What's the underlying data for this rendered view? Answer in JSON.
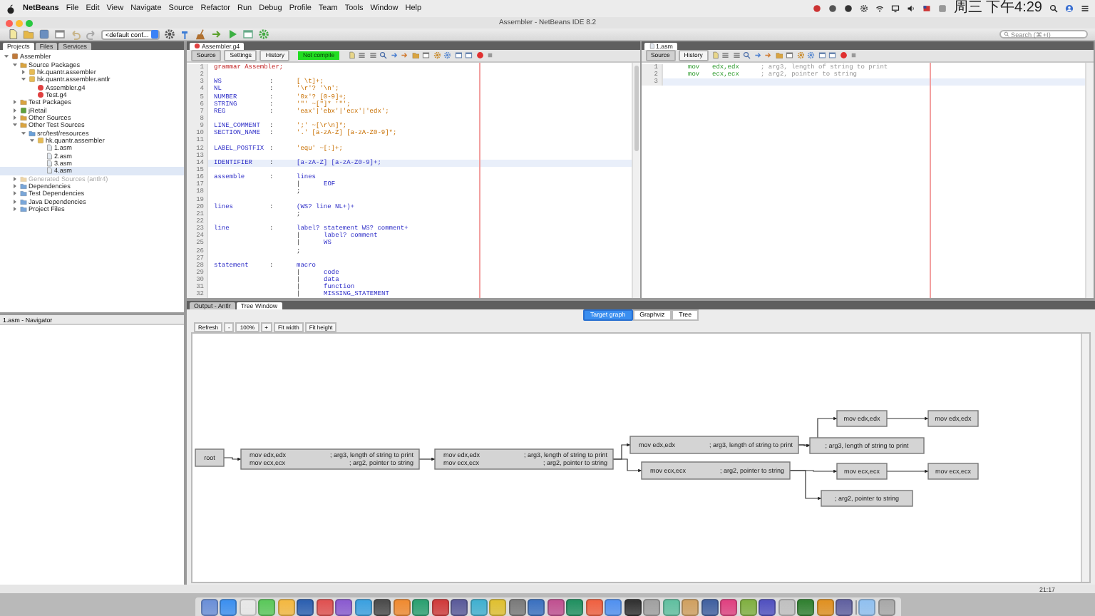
{
  "menubar": {
    "app": "NetBeans",
    "menus": [
      "File",
      "Edit",
      "View",
      "Navigate",
      "Source",
      "Refactor",
      "Run",
      "Debug",
      "Profile",
      "Team",
      "Tools",
      "Window",
      "Help"
    ],
    "clock": "周三 下午4:29"
  },
  "window": {
    "title": "Assembler - NetBeans IDE 8.2"
  },
  "toolbar": {
    "config": "<default conf...",
    "search": {
      "placeholder": "Search (⌘+I)"
    }
  },
  "left_tabs": [
    {
      "label": "Projects",
      "selected": true
    },
    {
      "label": "Files",
      "selected": false
    },
    {
      "label": "Services",
      "selected": false
    }
  ],
  "project_tree": [
    {
      "label": "Assembler",
      "kind": "project",
      "expanded": true,
      "selected": false,
      "children": [
        {
          "label": "Source Packages",
          "kind": "source-root",
          "expanded": true,
          "selected": false,
          "disabled": false,
          "children": [
            {
              "label": "hk.quantr.assembler",
              "kind": "package",
              "expanded": false,
              "selected": false
            },
            {
              "label": "hk.quantr.assembler.antlr",
              "kind": "package",
              "expanded": true,
              "selected": false,
              "children": [
                {
                  "label": "Assembler.g4",
                  "kind": "grammar",
                  "selected": false
                },
                {
                  "label": "Test.g4",
                  "kind": "grammar",
                  "selected": false
                }
              ]
            }
          ]
        },
        {
          "label": "Test Packages",
          "kind": "source-root",
          "expanded": false,
          "selected": false,
          "disabled": false
        },
        {
          "label": "jRetail",
          "kind": "library",
          "expanded": false,
          "selected": false,
          "disabled": false
        },
        {
          "label": "Other Sources",
          "kind": "source-root",
          "expanded": false,
          "selected": false,
          "disabled": false
        },
        {
          "label": "Other Test Sources",
          "kind": "source-root",
          "expanded": true,
          "selected": false,
          "disabled": false,
          "children": [
            {
              "label": "src/test/resources",
              "kind": "folder",
              "expanded": true,
              "selected": false,
              "children": [
                {
                  "label": "hk.quantr.assembler",
                  "kind": "package",
                  "expanded": true,
                  "selected": false,
                  "children": [
                    {
                      "label": "1.asm",
                      "kind": "asm",
                      "selected": false
                    },
                    {
                      "label": "2.asm",
                      "kind": "asm",
                      "selected": false
                    },
                    {
                      "label": "3.asm",
                      "kind": "asm",
                      "selected": false
                    },
                    {
                      "label": "4.asm",
                      "kind": "asm",
                      "selected": true
                    }
                  ]
                }
              ]
            }
          ]
        },
        {
          "label": "Generated Sources (antlr4)",
          "kind": "source-root",
          "expanded": false,
          "selected": false,
          "disabled": true
        },
        {
          "label": "Dependencies",
          "kind": "deps",
          "expanded": false,
          "selected": false,
          "disabled": false
        },
        {
          "label": "Test Dependencies",
          "kind": "deps",
          "expanded": false,
          "selected": false,
          "disabled": false
        },
        {
          "label": "Java Dependencies",
          "kind": "deps",
          "expanded": false,
          "selected": false,
          "disabled": false
        },
        {
          "label": "Project Files",
          "kind": "deps",
          "expanded": false,
          "selected": false,
          "disabled": false
        }
      ]
    }
  ],
  "navigator": {
    "title": "1.asm - Navigator"
  },
  "editors": [
    {
      "tab": "Assembler.g4",
      "kind": "grammar",
      "views": [
        {
          "label": "Source",
          "selected": true
        },
        {
          "label": "Settings",
          "selected": false
        },
        {
          "label": "History",
          "selected": false
        }
      ],
      "status": "Not compile",
      "lines": [
        {
          "number": "1",
          "kind": "header",
          "text": "grammar Assembler;",
          "current": false
        },
        {
          "number": "2",
          "kind": "blank",
          "current": false
        },
        {
          "number": "3",
          "kind": "lexer",
          "name": "WS",
          "sep": ":",
          "code": "[ \\t]+;",
          "current": false
        },
        {
          "number": "4",
          "kind": "lexer",
          "name": "NL",
          "sep": ":",
          "code": "'\\r'? '\\n';",
          "current": false
        },
        {
          "number": "5",
          "kind": "lexer",
          "name": "NUMBER",
          "sep": ":",
          "code": "'0x'? [0-9]+;",
          "current": false
        },
        {
          "number": "6",
          "kind": "lexer",
          "name": "STRING",
          "sep": ":",
          "code": "'\"' ~[\"]* '\"';",
          "current": false
        },
        {
          "number": "7",
          "kind": "lexer",
          "name": "REG",
          "sep": ":",
          "code": "'eax'|'ebx'|'ecx'|'edx';",
          "current": false
        },
        {
          "number": "8",
          "kind": "blank",
          "current": false
        },
        {
          "number": "9",
          "kind": "lexer",
          "name": "LINE_COMMENT",
          "sep": ":",
          "code": "';' ~[\\r\\n]*;",
          "current": false
        },
        {
          "number": "10",
          "kind": "lexer",
          "name": "SECTION_NAME",
          "sep": ":",
          "code": "'.' [a-zA-Z] [a-zA-Z0-9]*;",
          "current": false
        },
        {
          "number": "11",
          "kind": "blank",
          "current": false
        },
        {
          "number": "12",
          "kind": "lexer",
          "name": "LABEL_POSTFIX",
          "sep": ":",
          "code": "'equ' ~[:]+;",
          "current": false
        },
        {
          "number": "13",
          "kind": "blank",
          "current": false
        },
        {
          "number": "14",
          "kind": "parser",
          "name": "IDENTIFIER",
          "sep": ":",
          "code": "[a-zA-Z] [a-zA-Z0-9]+;",
          "current": true
        },
        {
          "number": "15",
          "kind": "blank",
          "current": false
        },
        {
          "number": "16",
          "kind": "parser",
          "name": "assemble",
          "sep": ":",
          "code": "lines",
          "current": false
        },
        {
          "number": "17",
          "kind": "alt",
          "sep": "|",
          "code": "EOF",
          "current": false
        },
        {
          "number": "18",
          "kind": "end",
          "code": ";",
          "current": false
        },
        {
          "number": "19",
          "kind": "blank",
          "current": false
        },
        {
          "number": "20",
          "kind": "parser",
          "name": "lines",
          "sep": ":",
          "code": "(WS? line NL+)+",
          "current": false
        },
        {
          "number": "21",
          "kind": "end",
          "code": ";",
          "current": false
        },
        {
          "number": "22",
          "kind": "blank",
          "current": false
        },
        {
          "number": "23",
          "kind": "parser",
          "name": "line",
          "sep": ":",
          "code": "label? statement WS? comment+",
          "current": false
        },
        {
          "number": "24",
          "kind": "alt",
          "sep": "|",
          "code": "label? comment",
          "current": false
        },
        {
          "number": "25",
          "kind": "alt",
          "sep": "|",
          "code": "WS",
          "current": false
        },
        {
          "number": "26",
          "kind": "end",
          "code": ";",
          "current": false
        },
        {
          "number": "27",
          "kind": "blank",
          "current": false
        },
        {
          "number": "28",
          "kind": "parser",
          "name": "statement",
          "sep": ":",
          "code": "macro",
          "current": false
        },
        {
          "number": "29",
          "kind": "alt",
          "sep": "|",
          "code": "code",
          "current": false
        },
        {
          "number": "30",
          "kind": "alt",
          "sep": "|",
          "code": "data",
          "current": false
        },
        {
          "number": "31",
          "kind": "alt",
          "sep": "|",
          "code": "function",
          "current": false
        },
        {
          "number": "32",
          "kind": "alt",
          "sep": "|",
          "code": "MISSING_STATEMENT",
          "current": false
        }
      ]
    },
    {
      "tab": "1.asm",
      "kind": "asm",
      "views": [
        {
          "label": "Source",
          "selected": true
        },
        {
          "label": "History",
          "selected": false
        }
      ],
      "lines": [
        {
          "number": "1",
          "kind": "asm",
          "op": "mov",
          "args": "edx,edx",
          "comment": "; arg3, length of string to print",
          "current": false
        },
        {
          "number": "2",
          "kind": "asm",
          "op": "mov",
          "args": "ecx,ecx",
          "comment": "; arg2, pointer to string",
          "current": false
        },
        {
          "number": "3",
          "kind": "blank",
          "current": true
        }
      ]
    }
  ],
  "output": {
    "tabs": [
      {
        "label": "Output - Antlr",
        "selected": false
      },
      {
        "label": "Tree Window",
        "selected": true
      }
    ],
    "views": [
      {
        "label": "Target graph",
        "selected": true
      },
      {
        "label": "Graphviz",
        "selected": false
      },
      {
        "label": "Tree",
        "selected": false
      }
    ],
    "zoom_controls": [
      "Refresh",
      "-",
      "100%",
      "+",
      "Fit width",
      "Fit height"
    ],
    "graph": {
      "nodes": [
        {
          "lines": [
            {
              "code": "root"
            }
          ]
        },
        {
          "lines": [
            {
              "code": "mov edx,edx",
              "comment": "; arg3, length of string to print"
            },
            {
              "code": "mov ecx,ecx",
              "comment": "; arg2, pointer to string"
            }
          ]
        },
        {
          "lines": [
            {
              "code": "mov edx,edx",
              "comment": "; arg3, length of string to print"
            },
            {
              "code": "mov ecx,ecx",
              "comment": "; arg2, pointer to string"
            }
          ]
        },
        {
          "lines": [
            {
              "code": "mov edx,edx",
              "comment": "; arg3, length of string to print"
            }
          ]
        },
        {
          "lines": [
            {
              "code": "mov ecx,ecx",
              "comment": "; arg2, pointer to string"
            }
          ]
        },
        {
          "lines": [
            {
              "code": "mov edx,edx"
            }
          ]
        },
        {
          "lines": [
            {
              "code": "mov edx,edx"
            }
          ]
        },
        {
          "lines": [
            {
              "comment": "; arg3, length of string to print"
            }
          ]
        },
        {
          "lines": [
            {
              "code": "mov ecx,ecx"
            }
          ]
        },
        {
          "lines": [
            {
              "code": "mov ecx,ecx"
            }
          ]
        },
        {
          "lines": [
            {
              "comment": "; arg2, pointer to string"
            }
          ]
        }
      ]
    }
  },
  "status_bar": {
    "time": "21:17"
  }
}
